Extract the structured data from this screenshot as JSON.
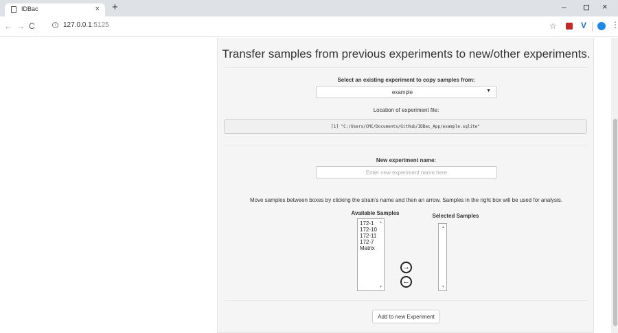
{
  "browser": {
    "tab_title": "IDBac",
    "tab_close": "×",
    "new_tab": "+",
    "url_host": "127.0.0.1",
    "url_port": ":5125",
    "window_controls": {
      "minimize": "–",
      "close": "×"
    },
    "icons": [
      "page-icon",
      "back-arrow-icon",
      "forward-arrow-icon",
      "reload-icon",
      "info-icon",
      "star-icon",
      "extension-icon",
      "vue-extension-icon",
      "profile-icon",
      "menu-icon"
    ]
  },
  "page": {
    "heading": "Transfer samples from previous experiments to new/other experiments.",
    "select_label": "Select an existing experiment to copy samples from:",
    "select_value": "example",
    "location_label": "Location of experiment file:",
    "location_path": "[1] \"C:/Users/CMC/Documents/GitHub/IDBac_App/example.sqlite\"",
    "new_name_label": "New experiment name:",
    "new_name_placeholder": "Enter new experiment name here",
    "instructions": "Move samples between boxes by clicking the strain's name and then an arrow. Samples in the right box will be used for analysis.",
    "available_label": "Available Samples",
    "selected_label": "Selected Samples",
    "available_samples": [
      "172-1",
      "172-10",
      "172-11",
      "172-7",
      "Matrix"
    ],
    "selected_samples": [],
    "move_right_symbol": "→",
    "move_left_symbol": "←",
    "add_button": "Add to new Experiment"
  }
}
